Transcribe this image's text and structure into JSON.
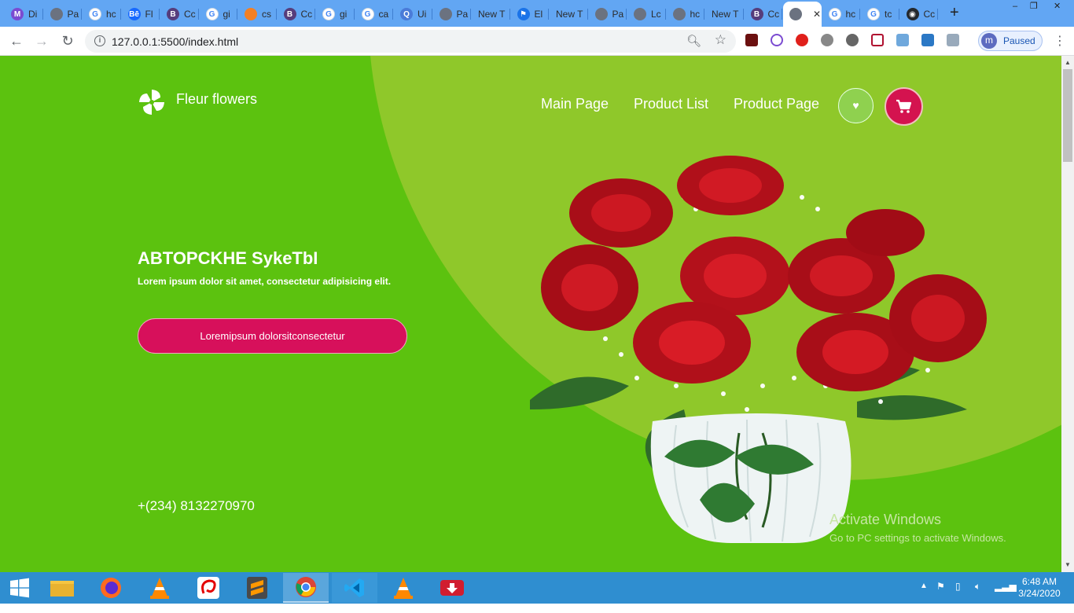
{
  "browser": {
    "tabs": [
      {
        "label": "Di",
        "color": "#7b4bd1",
        "glyph": "M"
      },
      {
        "label": "Pa",
        "color": "#6b7280",
        "glyph": ""
      },
      {
        "label": "hc",
        "color": "#ffffff",
        "glyph": "G"
      },
      {
        "label": "Fl",
        "color": "#1769ff",
        "glyph": "Bē"
      },
      {
        "label": "Cc",
        "color": "#563d7c",
        "glyph": "B"
      },
      {
        "label": "gi",
        "color": "#ffffff",
        "glyph": "G"
      },
      {
        "label": "cs",
        "color": "#f48024",
        "glyph": ""
      },
      {
        "label": "Cc",
        "color": "#563d7c",
        "glyph": "B"
      },
      {
        "label": "gi",
        "color": "#ffffff",
        "glyph": "G"
      },
      {
        "label": "ca",
        "color": "#ffffff",
        "glyph": "G"
      },
      {
        "label": "Ui",
        "color": "#4a7bd8",
        "glyph": "Q"
      },
      {
        "label": "Pa",
        "color": "#6b7280",
        "glyph": ""
      },
      {
        "label": "New T",
        "color": "",
        "glyph": ""
      },
      {
        "label": "El",
        "color": "#1a73e8",
        "glyph": "⚑"
      },
      {
        "label": "New T",
        "color": "",
        "glyph": ""
      },
      {
        "label": "Pa",
        "color": "#6b7280",
        "glyph": ""
      },
      {
        "label": "Lc",
        "color": "#6b7280",
        "glyph": ""
      },
      {
        "label": "hc",
        "color": "#6b7280",
        "glyph": ""
      },
      {
        "label": "New T",
        "color": "",
        "glyph": ""
      },
      {
        "label": "Cc",
        "color": "#563d7c",
        "glyph": "B"
      },
      {
        "label": "",
        "color": "#6b7280",
        "glyph": "",
        "active": true
      },
      {
        "label": "hc",
        "color": "#ffffff",
        "glyph": "G"
      },
      {
        "label": "tc",
        "color": "#ffffff",
        "glyph": "G"
      },
      {
        "label": "Cc",
        "color": "#24292e",
        "glyph": "◉"
      }
    ],
    "url": "127.0.0.1:5500/index.html",
    "profile_initial": "m",
    "profile_status": "Paused"
  },
  "site": {
    "brand": "Fleur flowers",
    "nav": [
      "Main Page",
      "Product List",
      "Product Page"
    ],
    "hero_title": "ABTOPCKHE SykeTbI",
    "hero_subtitle": "Lorem ipsum dolor sit amet, consectetur adipisicing elit.",
    "cta_label": "Loremipsum dolorsitconsectetur",
    "phone": "+(234) 8132270970"
  },
  "watermark": {
    "title": "Activate Windows",
    "subtitle": "Go to PC settings to activate Windows."
  },
  "taskbar": {
    "apps": [
      "windows-start",
      "file-explorer",
      "firefox",
      "vlc",
      "airtel",
      "sublime-text",
      "chrome",
      "vscode",
      "vlc",
      "downloader"
    ],
    "time": "6:48 AM",
    "date": "3/24/2020"
  },
  "colors": {
    "page_green": "#5cc20f",
    "circle_green": "#8fc82a",
    "accent_pink": "#d7105b"
  }
}
